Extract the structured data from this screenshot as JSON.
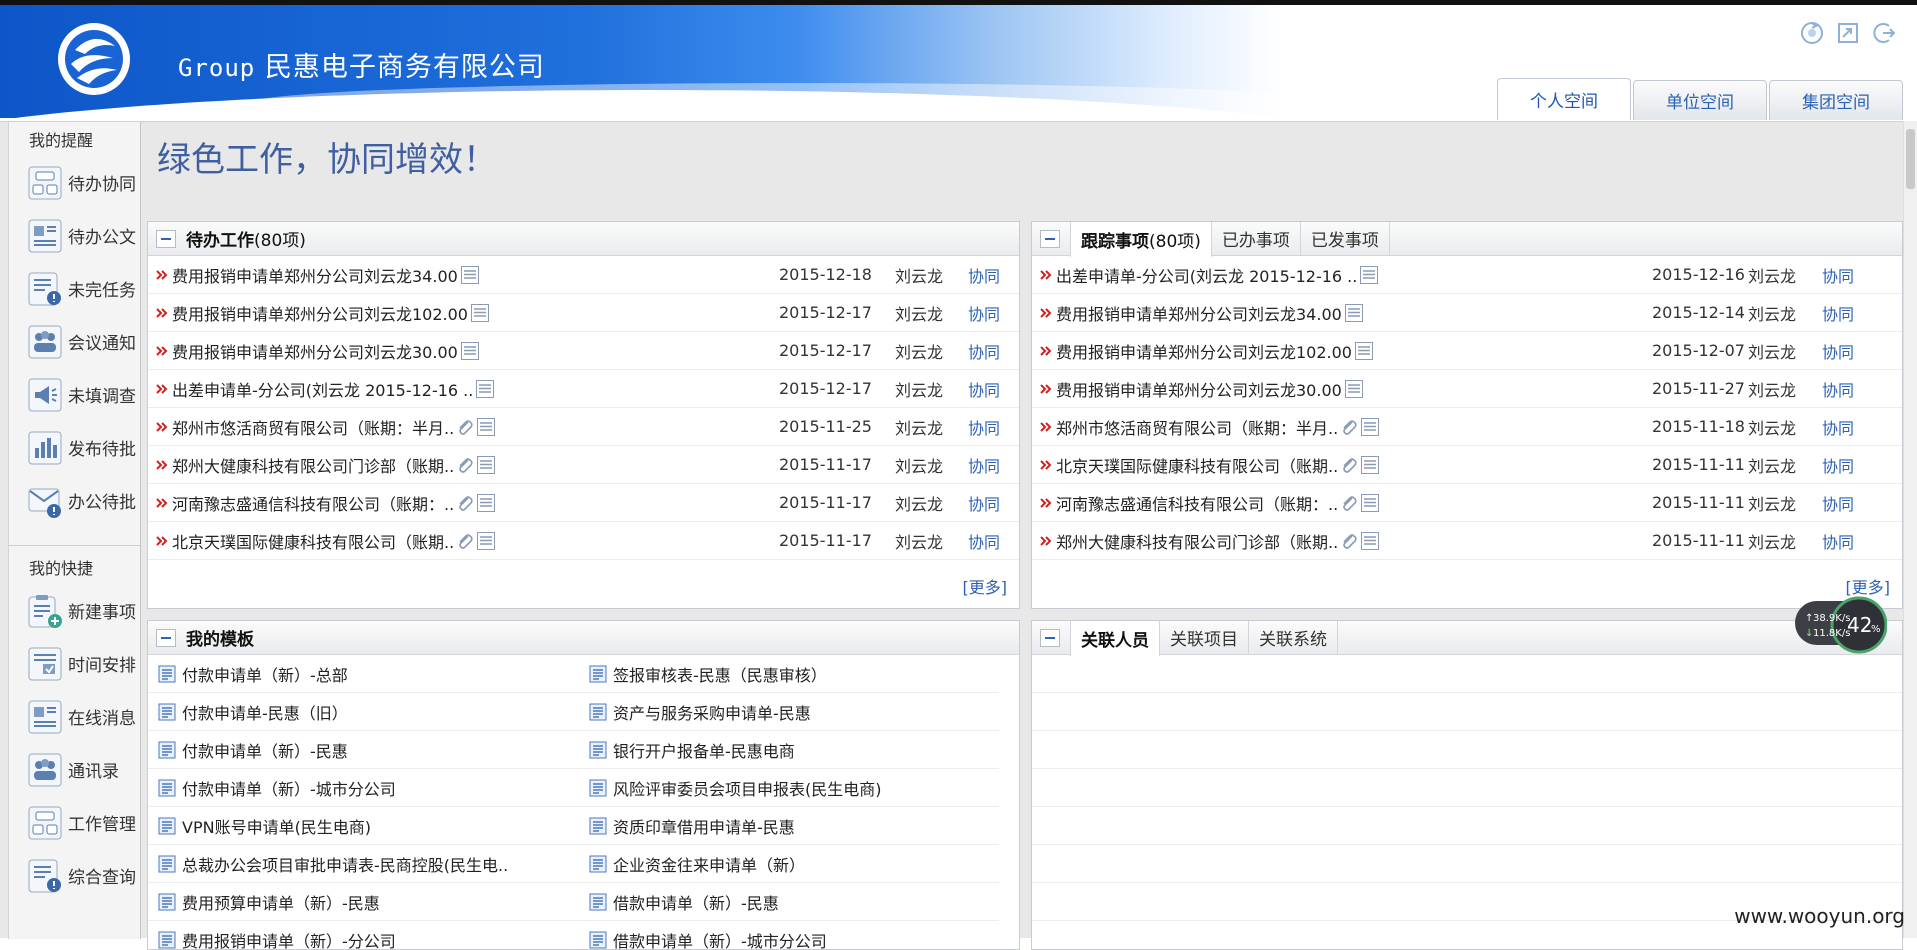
{
  "header": {
    "company_prefix": "Group",
    "company_name": "民惠电子商务有限公司",
    "space_tabs": [
      {
        "label": "个人空间",
        "active": true
      },
      {
        "label": "单位空间",
        "active": false
      },
      {
        "label": "集团空间",
        "active": false
      }
    ],
    "icons": [
      "refresh-icon",
      "export-icon",
      "logout-icon"
    ]
  },
  "sidebar": {
    "reminders_title": "我的提醒",
    "reminders": [
      "待办协同",
      "待办公文",
      "未完任务",
      "会议通知",
      "未填调查",
      "发布待批",
      "办公待批"
    ],
    "shortcuts_title": "我的快捷",
    "shortcuts": [
      "新建事项",
      "时间安排",
      "在线消息",
      "通讯录",
      "工作管理",
      "综合查询"
    ]
  },
  "slogan": "绿色工作，协同增效！",
  "pending": {
    "title": "待办工作",
    "count": "(80项)",
    "more": "[更多]",
    "rows": [
      {
        "title": "费用报销申请单郑州分公司刘云龙34.00",
        "clip": false,
        "date": "2015-12-18",
        "person": "刘云龙",
        "type": "协同"
      },
      {
        "title": "费用报销申请单郑州分公司刘云龙102.00",
        "clip": false,
        "date": "2015-12-17",
        "person": "刘云龙",
        "type": "协同"
      },
      {
        "title": "费用报销申请单郑州分公司刘云龙30.00",
        "clip": false,
        "date": "2015-12-17",
        "person": "刘云龙",
        "type": "协同"
      },
      {
        "title": "出差申请单-分公司(刘云龙 2015-12-16 ..",
        "clip": false,
        "date": "2015-12-17",
        "person": "刘云龙",
        "type": "协同"
      },
      {
        "title": "郑州市悠活商贸有限公司（账期：半月..",
        "clip": true,
        "date": "2015-11-25",
        "person": "刘云龙",
        "type": "协同"
      },
      {
        "title": "郑州大健康科技有限公司门诊部（账期..",
        "clip": true,
        "date": "2015-11-17",
        "person": "刘云龙",
        "type": "协同"
      },
      {
        "title": "河南豫志盛通信科技有限公司（账期：..",
        "clip": true,
        "date": "2015-11-17",
        "person": "刘云龙",
        "type": "协同"
      },
      {
        "title": "北京天璞国际健康科技有限公司（账期..",
        "clip": true,
        "date": "2015-11-17",
        "person": "刘云龙",
        "type": "协同"
      }
    ]
  },
  "tracking": {
    "tabs": [
      {
        "label": "跟踪事项",
        "count": "(80项)",
        "active": true
      },
      {
        "label": "已办事项",
        "count": "",
        "active": false
      },
      {
        "label": "已发事项",
        "count": "",
        "active": false
      }
    ],
    "more": "[更多]",
    "rows": [
      {
        "title": "出差申请单-分公司(刘云龙 2015-12-16 ..",
        "clip": false,
        "date": "2015-12-16",
        "person": "刘云龙",
        "type": "协同"
      },
      {
        "title": "费用报销申请单郑州分公司刘云龙34.00",
        "clip": false,
        "date": "2015-12-14",
        "person": "刘云龙",
        "type": "协同"
      },
      {
        "title": "费用报销申请单郑州分公司刘云龙102.00",
        "clip": false,
        "date": "2015-12-07",
        "person": "刘云龙",
        "type": "协同"
      },
      {
        "title": "费用报销申请单郑州分公司刘云龙30.00",
        "clip": false,
        "date": "2015-11-27",
        "person": "刘云龙",
        "type": "协同"
      },
      {
        "title": "郑州市悠活商贸有限公司（账期：半月..",
        "clip": true,
        "date": "2015-11-18",
        "person": "刘云龙",
        "type": "协同"
      },
      {
        "title": "北京天璞国际健康科技有限公司（账期..",
        "clip": true,
        "date": "2015-11-11",
        "person": "刘云龙",
        "type": "协同"
      },
      {
        "title": "河南豫志盛通信科技有限公司（账期：..",
        "clip": true,
        "date": "2015-11-11",
        "person": "刘云龙",
        "type": "协同"
      },
      {
        "title": "郑州大健康科技有限公司门诊部（账期..",
        "clip": true,
        "date": "2015-11-11",
        "person": "刘云龙",
        "type": "协同"
      }
    ]
  },
  "templates": {
    "title": "我的模板",
    "items": [
      "付款申请单（新）-总部",
      "签报审核表-民惠（民惠审核）",
      "付款申请单-民惠（旧）",
      "资产与服务采购申请单-民惠",
      "付款申请单（新）-民惠",
      "银行开户报备单-民惠电商",
      "付款申请单（新）-城市分公司",
      "风险评审委员会项目申报表(民生电商)",
      "VPN账号申请单(民生电商)",
      "资质印章借用申请单-民惠",
      "总裁办公会项目审批申请表-民商控股(民生电..",
      "企业资金往来申请单（新）",
      "费用预算申请单（新）-民惠",
      "借款申请单（新）-民惠",
      "费用报销申请单（新）-分公司",
      "借款申请单（新）-城市分公司"
    ]
  },
  "related": {
    "tabs": [
      {
        "label": "关联人员",
        "active": true
      },
      {
        "label": "关联项目",
        "active": false
      },
      {
        "label": "关联系统",
        "active": false
      }
    ]
  },
  "speed_widget": {
    "up": "38.9K/s",
    "down": "11.8K/s",
    "percent": "42",
    "percent_unit": "%"
  },
  "watermark": "www.wooyun.org"
}
